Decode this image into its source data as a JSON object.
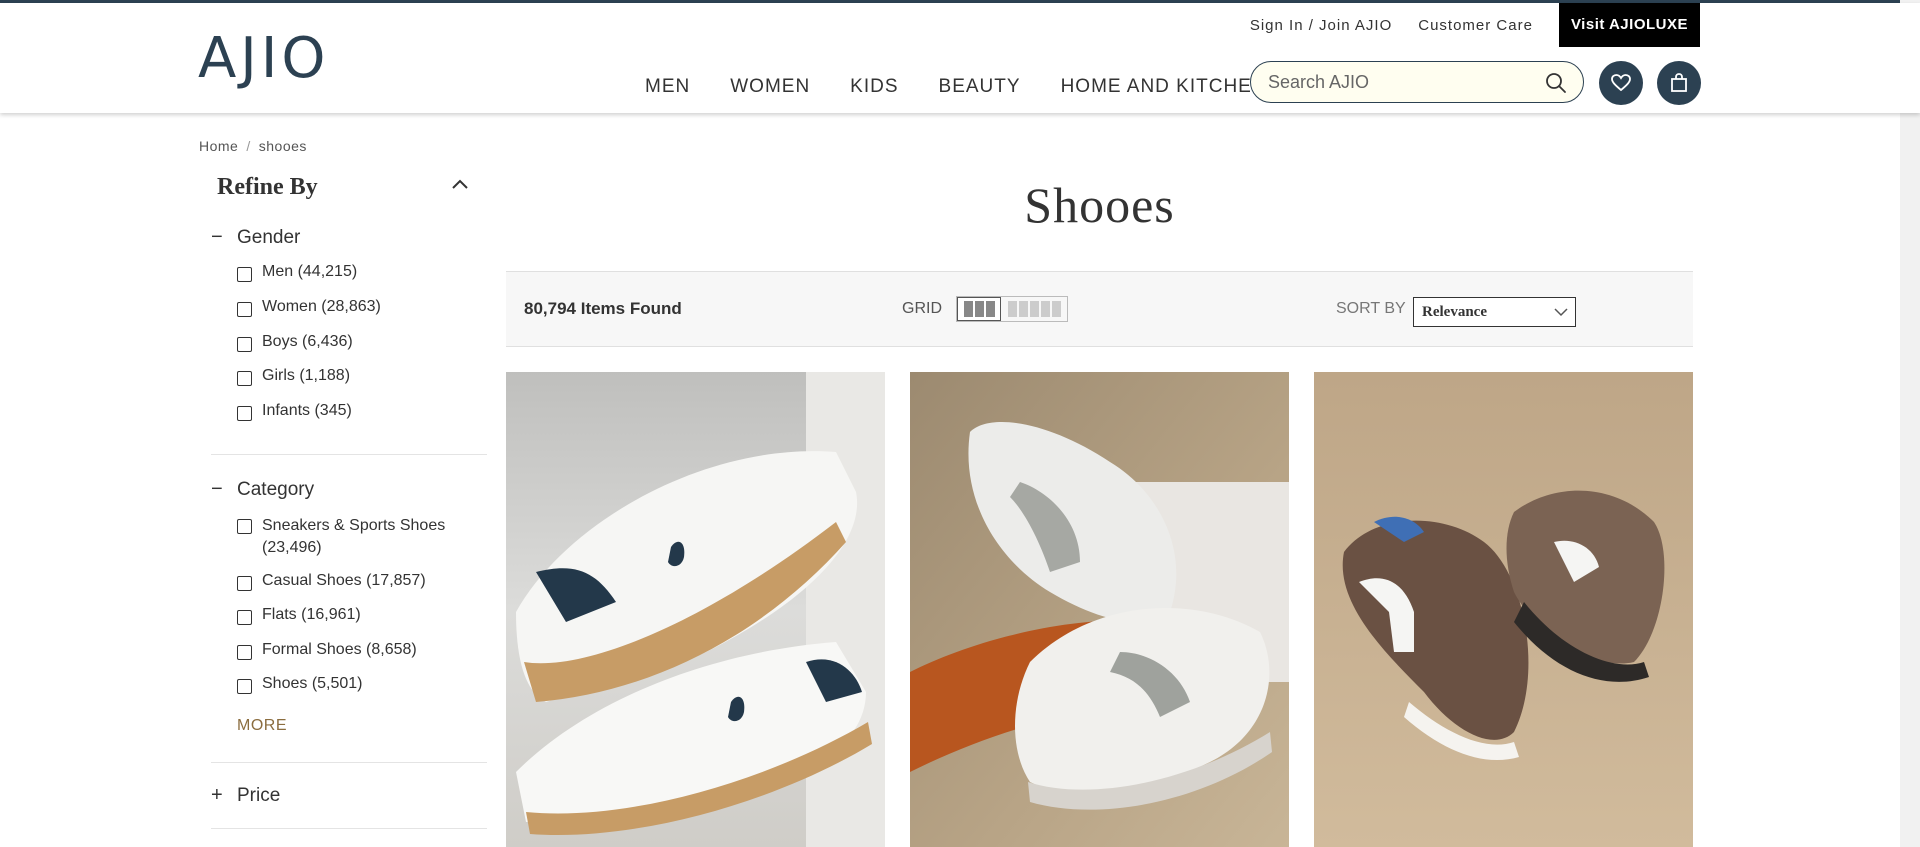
{
  "header": {
    "logo": "AJIO",
    "top_links": [
      "Sign In / Join AJIO",
      "Customer Care"
    ],
    "luxe_button": "Visit AJIOLUXE",
    "nav": [
      "MEN",
      "WOMEN",
      "KIDS",
      "BEAUTY",
      "HOME AND KITCHEN"
    ],
    "search_placeholder": "Search AJIO",
    "icons": [
      "search-icon",
      "heart-icon",
      "bag-icon"
    ]
  },
  "breadcrumb": {
    "home": "Home",
    "separator": "/",
    "current": "shooes"
  },
  "sidebar": {
    "refine_title": "Refine By",
    "gender": {
      "title": "Gender",
      "toggle": "−",
      "options": [
        "Men (44,215)",
        "Women (28,863)",
        "Boys (6,436)",
        "Girls (1,188)",
        "Infants (345)"
      ]
    },
    "category": {
      "title": "Category",
      "toggle": "−",
      "options": [
        "Sneakers & Sports Shoes (23,496)",
        "Casual Shoes (17,857)",
        "Flats (16,961)",
        "Formal Shoes (8,658)",
        "Shoes (5,501)"
      ],
      "more": "MORE"
    },
    "price": {
      "title": "Price",
      "toggle": "+"
    }
  },
  "main": {
    "title": "Shooes",
    "items_found": "80,794 Items Found",
    "grid_label": "GRID",
    "sort_label": "SORT BY",
    "sort_value": "Relevance"
  },
  "colors": {
    "brand": "#2c4152",
    "luxe_bg": "#000000",
    "more_link": "#8b6d3f",
    "search_bg": "#fffef0"
  }
}
